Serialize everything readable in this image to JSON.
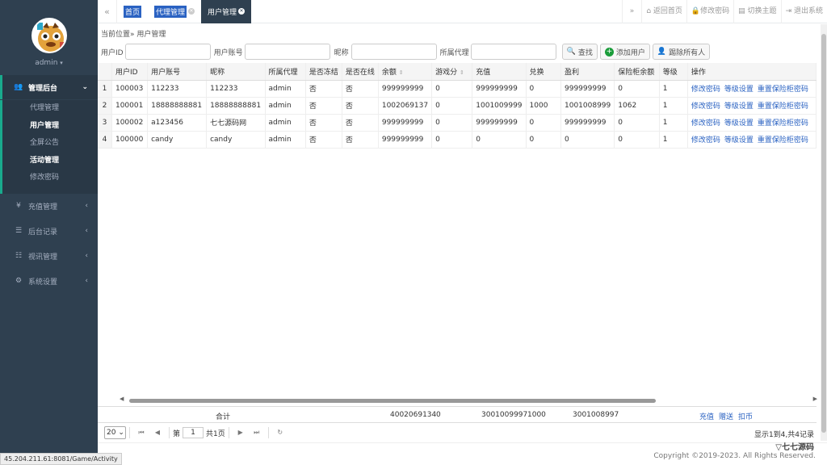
{
  "sidebar": {
    "user": "admin",
    "groups": [
      {
        "icon": "users-icon",
        "label": "管理后台"
      },
      {
        "icon": "yen-icon",
        "label": "充值管理"
      },
      {
        "icon": "list-icon",
        "label": "后台记录"
      },
      {
        "icon": "menu-icon",
        "label": "视讯管理"
      },
      {
        "icon": "gears-icon",
        "label": "系统设置"
      }
    ],
    "sub_items": [
      "代理管理",
      "用户管理",
      "全屏公告",
      "活动管理",
      "修改密码"
    ]
  },
  "tabs": [
    {
      "label": "首页"
    },
    {
      "label": "代理管理"
    },
    {
      "label": "用户管理"
    }
  ],
  "top_actions": {
    "home": "返回首页",
    "change_password": "修改密码",
    "switch_theme": "切换主题",
    "logout": "退出系统"
  },
  "breadcrumb": "当前位置» 用户管理",
  "search": {
    "user_id": "用户ID",
    "account": "用户账号",
    "nickname": "昵称",
    "agent": "所属代理",
    "find": "查找",
    "add": "添加用户",
    "kick": "踢除所有人"
  },
  "columns": [
    "用户ID",
    "用户账号",
    "昵称",
    "所属代理",
    "是否冻结",
    "是否在线",
    "余额",
    "游戏分",
    "充值",
    "兑换",
    "盈利",
    "保险柜余额",
    "等级",
    "操作"
  ],
  "rows": [
    {
      "n": "1",
      "id": "100003",
      "account": "112233",
      "nick": "112233",
      "agent": "admin",
      "frozen": "否",
      "online": "否",
      "balance": "999999999",
      "score": "0",
      "recharge": "999999999",
      "exchange": "0",
      "profit": "999999999",
      "safe": "0",
      "level": "1"
    },
    {
      "n": "2",
      "id": "100001",
      "account": "18888888881",
      "nick": "18888888881",
      "agent": "admin",
      "frozen": "否",
      "online": "否",
      "balance": "1002069137",
      "score": "0",
      "recharge": "1001009999",
      "exchange": "1000",
      "profit": "1001008999",
      "safe": "1062",
      "level": "1"
    },
    {
      "n": "3",
      "id": "100002",
      "account": "a123456",
      "nick": "七七源码网",
      "agent": "admin",
      "frozen": "否",
      "online": "否",
      "balance": "999999999",
      "score": "0",
      "recharge": "999999999",
      "exchange": "0",
      "profit": "999999999",
      "safe": "0",
      "level": "1"
    },
    {
      "n": "4",
      "id": "100000",
      "account": "candy",
      "nick": "candy",
      "agent": "admin",
      "frozen": "否",
      "online": "否",
      "balance": "999999999",
      "score": "0",
      "recharge": "0",
      "exchange": "0",
      "profit": "0",
      "safe": "0",
      "level": "1"
    }
  ],
  "row_actions": [
    "修改密码",
    "等级设置",
    "重置保险柜密码"
  ],
  "totals": {
    "label": "合计",
    "balance": "4002069134",
    "score": "0",
    "recharge": "3001009997",
    "exchange": "1000",
    "profit": "3001008997",
    "actions": [
      "充值",
      "赠送",
      "扣币"
    ]
  },
  "pager": {
    "page_size": "20",
    "page_prefix": "第",
    "page": "1",
    "page_total": "共1页",
    "info": "显示1到4,共4记录"
  },
  "footer": {
    "copyright": "Copyright ©2019-2023. All Rights Reserved.",
    "logo": "七七源码"
  },
  "status_url": "45.204.211.61:8081/Game/Activity"
}
